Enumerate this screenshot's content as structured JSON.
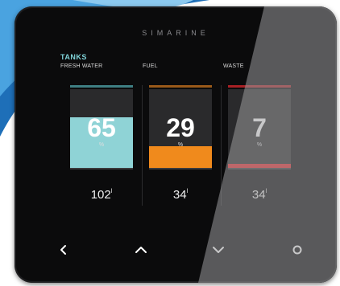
{
  "device": {
    "brand": "SIMARINE"
  },
  "screen": {
    "section_title": "TANKS"
  },
  "tanks": [
    {
      "label": "FRESH WATER",
      "percent": "65",
      "percent_value": 65,
      "unit": "%",
      "volume": "102",
      "volume_unit": "l",
      "color": "#8fd3d6",
      "top_color": "#3e7f83"
    },
    {
      "label": "FUEL",
      "percent": "29",
      "percent_value": 29,
      "unit": "%",
      "volume": "34",
      "volume_unit": "l",
      "color": "#f08a1c",
      "top_color": "#9a5a1a"
    },
    {
      "label": "WASTE",
      "percent": "7",
      "percent_value": 7,
      "unit": "%",
      "volume": "34",
      "volume_unit": "l",
      "color": "#e8282e",
      "top_color": "#a82024"
    }
  ],
  "nav": {
    "left": "chevron-left-icon",
    "up": "chevron-up-icon",
    "down": "chevron-down-icon",
    "home": "circle-icon"
  }
}
